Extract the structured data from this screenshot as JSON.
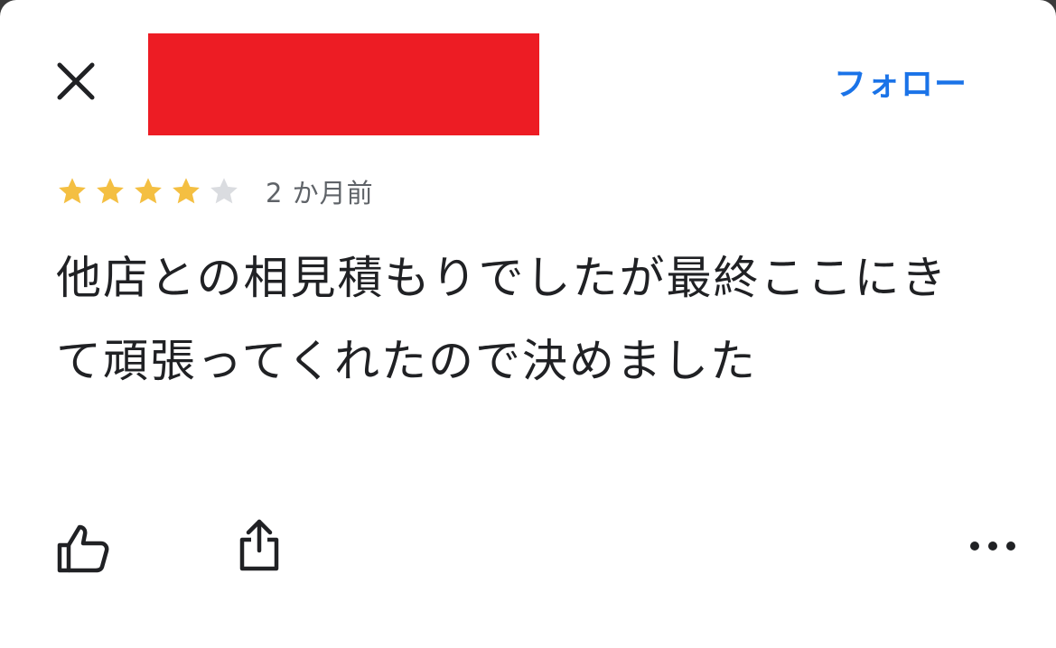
{
  "header": {
    "follow_label": "フォロー"
  },
  "review": {
    "rating": 4,
    "rating_max": 5,
    "time_ago": "2 か月前",
    "text": "他店との相見積もりでしたが最終ここにきて頑張ってくれたので決めました"
  },
  "actions": {
    "like_icon": "thumbs-up-icon",
    "share_icon": "share-icon",
    "more_icon": "more-horiz-icon"
  },
  "colors": {
    "accent": "#1a73e8",
    "star_filled": "#f4bf42",
    "star_empty": "#dadce0",
    "redaction": "#ed1c24"
  }
}
